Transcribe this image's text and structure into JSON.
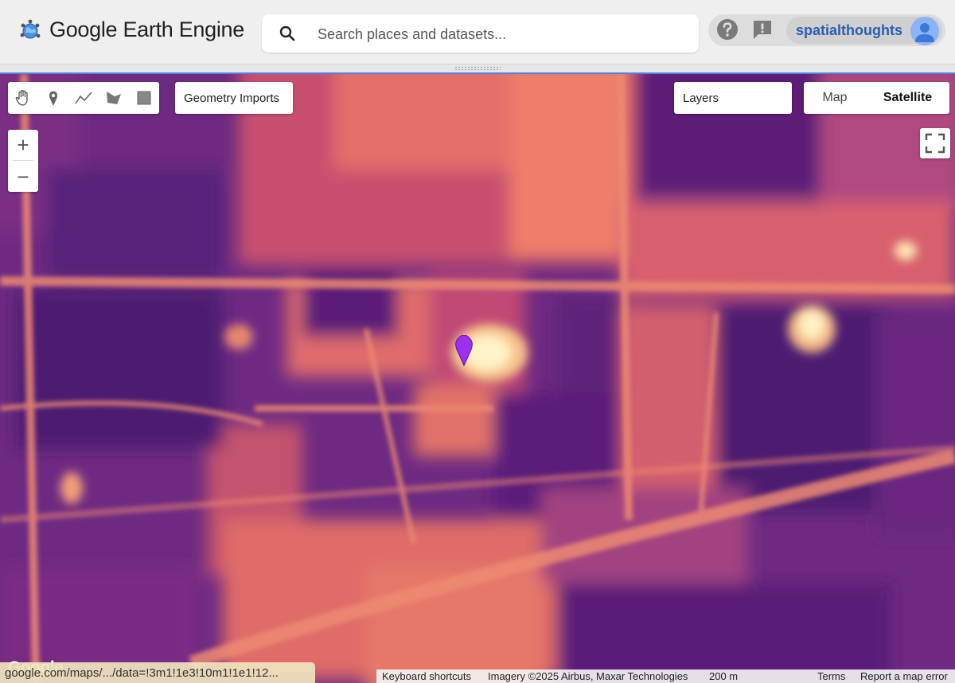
{
  "app": {
    "title": "Google Earth Engine"
  },
  "search": {
    "placeholder": "Search places and datasets..."
  },
  "account": {
    "help_icon": "help-circle-icon",
    "feedback_icon": "feedback-icon",
    "username": "spatialthoughts",
    "avatar_icon": "user-avatar-icon"
  },
  "map": {
    "drawing_tools": [
      "hand-icon",
      "marker-icon",
      "line-icon",
      "polygon-icon",
      "rectangle-icon"
    ],
    "geometry_imports_label": "Geometry Imports",
    "layers_label": "Layers",
    "map_type": {
      "options": [
        "Map",
        "Satellite"
      ],
      "selected": "Satellite"
    },
    "zoom_in_label": "+",
    "zoom_out_label": "−",
    "watermark": "Google",
    "url_text": "google.com/maps/.../data=!3m1!1e3!10m1!1e1!12...",
    "attribution": {
      "keyboard_shortcuts": "Keyboard shortcuts",
      "imagery": "Imagery ©2025 Airbus, Maxar Technologies",
      "scale": "200 m",
      "terms": "Terms",
      "report": "Report a map error"
    },
    "colors": {
      "dark": "#5a2078",
      "mid": "#a83c86",
      "bright": "#e87a6a",
      "highlight": "#fff2c0",
      "pin": "#9b30f0"
    }
  }
}
